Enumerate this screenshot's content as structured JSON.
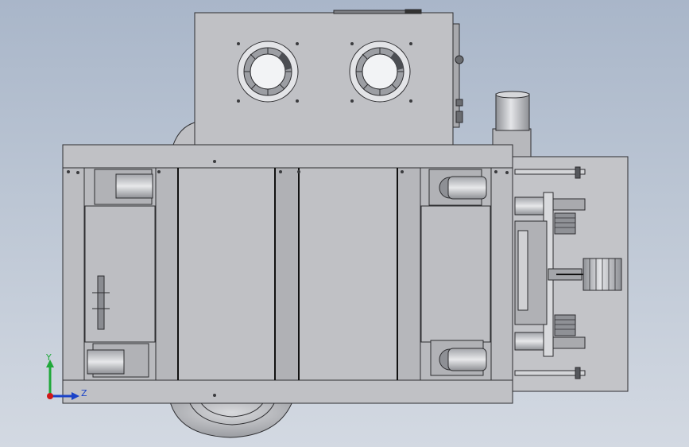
{
  "triad": {
    "y_label": "Y",
    "z_label": "Z",
    "y_color": "#1fa83a",
    "z_color": "#1a43c8",
    "origin_color": "#d01818"
  },
  "colors": {
    "body": "#c0c1c5",
    "frame": "#b4b5b9",
    "edge": "#2d2d30",
    "panel": "#b7b8bc",
    "dark": "#55575c"
  }
}
